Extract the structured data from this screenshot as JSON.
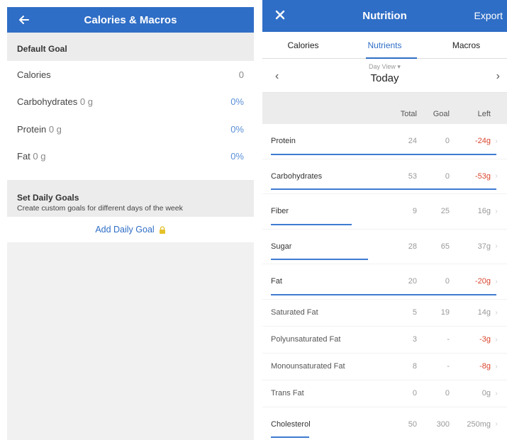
{
  "left": {
    "title": "Calories & Macros",
    "default_goal_header": "Default Goal",
    "rows": [
      {
        "label": "Calories",
        "grams": "",
        "value": "0"
      },
      {
        "label": "Carbohydrates",
        "grams": "0 g",
        "value": "0%"
      },
      {
        "label": "Protein",
        "grams": "0 g",
        "value": "0%"
      },
      {
        "label": "Fat",
        "grams": "0 g",
        "value": "0%"
      }
    ],
    "set_daily_goals_title": "Set Daily Goals",
    "set_daily_goals_subtitle": "Create custom goals for different days of the week",
    "add_daily_goal": "Add Daily Goal"
  },
  "right": {
    "title": "Nutrition",
    "export": "Export",
    "tabs": [
      "Calories",
      "Nutrients",
      "Macros"
    ],
    "active_tab": "Nutrients",
    "day_view_label": "Day View",
    "day": "Today",
    "columns": [
      "Total",
      "Goal",
      "Left"
    ],
    "nutrients": [
      {
        "name": "Protein",
        "total": "24",
        "goal": "0",
        "left": "-24g",
        "negative": true,
        "progress": 1.0,
        "bold": true
      },
      {
        "name": "Carbohydrates",
        "total": "53",
        "goal": "0",
        "left": "-53g",
        "negative": true,
        "progress": 1.0,
        "bold": true
      },
      {
        "name": "Fiber",
        "total": "9",
        "goal": "25",
        "left": "16g",
        "negative": false,
        "progress": 0.36,
        "bold": true
      },
      {
        "name": "Sugar",
        "total": "28",
        "goal": "65",
        "left": "37g",
        "negative": false,
        "progress": 0.43,
        "bold": true
      },
      {
        "name": "Fat",
        "total": "20",
        "goal": "0",
        "left": "-20g",
        "negative": true,
        "progress": 1.0,
        "bold": true
      },
      {
        "name": "Saturated Fat",
        "total": "5",
        "goal": "19",
        "left": "14g",
        "negative": false,
        "progress": 0,
        "bold": false
      },
      {
        "name": "Polyunsaturated Fat",
        "total": "3",
        "goal": "-",
        "left": "-3g",
        "negative": true,
        "progress": 0,
        "bold": false
      },
      {
        "name": "Monounsaturated Fat",
        "total": "8",
        "goal": "-",
        "left": "-8g",
        "negative": true,
        "progress": 0,
        "bold": false
      },
      {
        "name": "Trans Fat",
        "total": "0",
        "goal": "0",
        "left": "0g",
        "negative": false,
        "progress": 0,
        "bold": false
      },
      {
        "name": "Cholesterol",
        "total": "50",
        "goal": "300",
        "left": "250mg",
        "negative": false,
        "progress": 0.17,
        "bold": true
      }
    ]
  },
  "colors": {
    "brand": "#2f6ec6",
    "negative": "#d9462e",
    "lock": "#e6c229"
  }
}
